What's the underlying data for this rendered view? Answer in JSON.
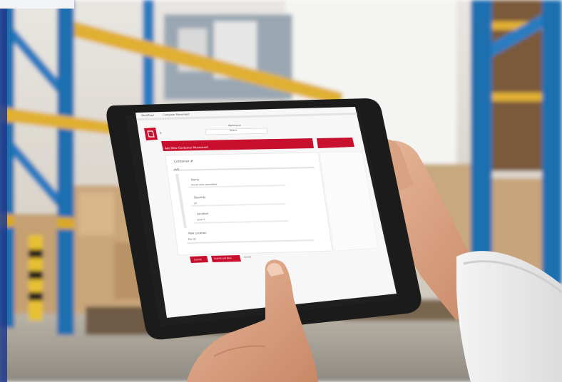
{
  "tablet_app": {
    "breadcrumb": {
      "home": "Workflows",
      "current": "Container Movement"
    },
    "header": {
      "user": "JL",
      "dropdown_label": "Warehouse",
      "dropdown_value": "Select"
    },
    "form": {
      "title": "Add New Container Movement",
      "sections": [
        {
          "label": "Container #",
          "value": "AVG"
        },
        {
          "label": "Name",
          "value": "Anchor bolts assembled"
        },
        {
          "label": "Quantity",
          "value": "24"
        },
        {
          "label": "Location",
          "value": "Level 3"
        },
        {
          "label": "New Location",
          "value": "Bay 3B"
        }
      ],
      "buttons": {
        "submit": "Submit",
        "submit_another": "Submit and New",
        "cancel": "Cancel"
      }
    }
  },
  "colors": {
    "brand_red": "#c8102e",
    "shelf_blue": "#1f6fb0",
    "shelf_yellow": "#e0b030",
    "cardboard": "#c9a67a",
    "tablet_bezel": "#1b1b1b"
  }
}
